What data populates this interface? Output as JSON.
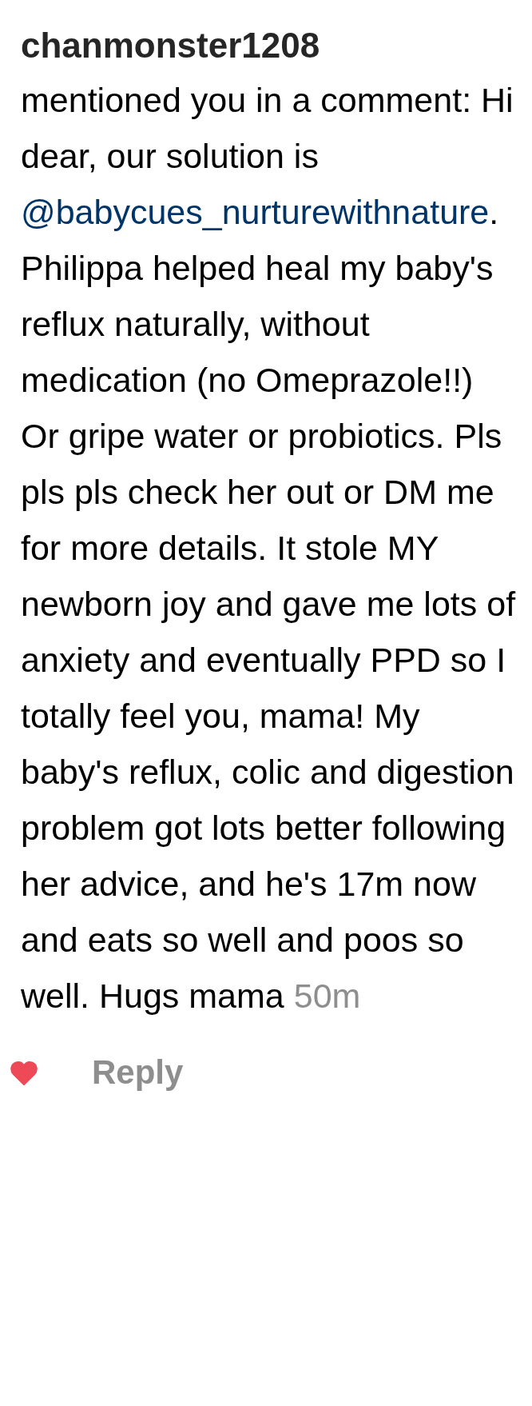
{
  "notification": {
    "username": "chanmonster1208",
    "text_before": "mentioned you in a comment: Hi dear, our solution is ",
    "mention": "@babycues_nurturewithnature",
    "text_after": ". Philippa helped heal my baby's reflux naturally, without medication (no Omeprazole!!) Or gripe water or probiotics. Pls pls pls check her out or DM me for more details. It stole MY newborn joy and gave me lots of anxiety and eventually PPD so I totally feel you, mama! My baby's reflux, colic and digestion problem got lots better following her advice, and he's 17m now and eats so well and poos so well. Hugs mama",
    "time": "50m"
  },
  "actions": {
    "liked": true,
    "reply": "Reply"
  }
}
